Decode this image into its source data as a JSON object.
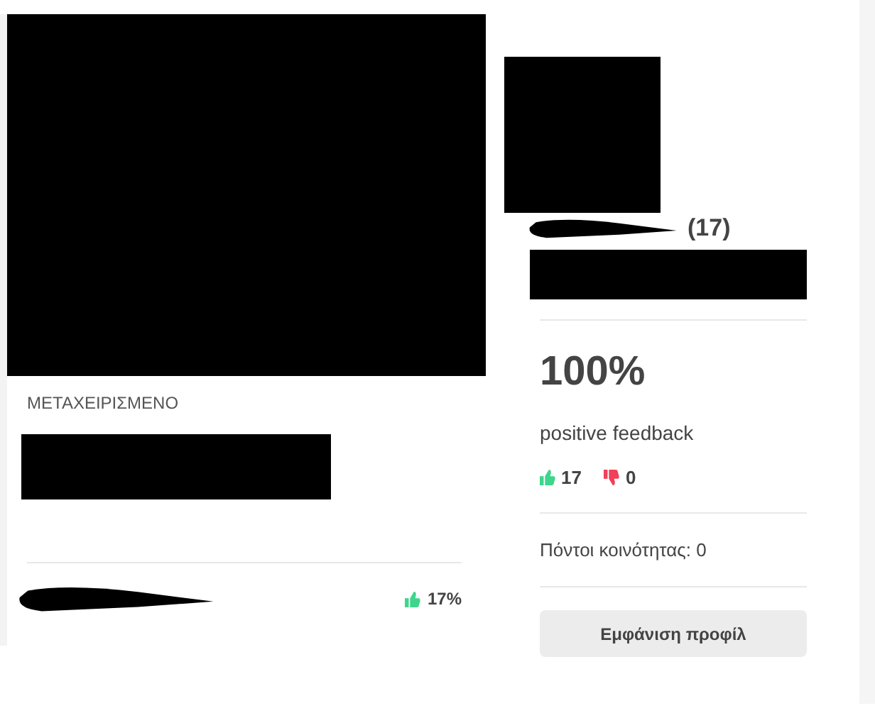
{
  "listing": {
    "condition": "ΜΕΤΑΧΕΙΡΙΣΜΕΝΟ",
    "seller_rating": "17%"
  },
  "seller": {
    "review_count": "(17)",
    "score": "100%",
    "score_label": "positive feedback",
    "positive_count": "17",
    "negative_count": "0",
    "community_points": "Πόντοι κοινότητας: 0",
    "profile_button": "Εμφάνιση προφίλ"
  }
}
